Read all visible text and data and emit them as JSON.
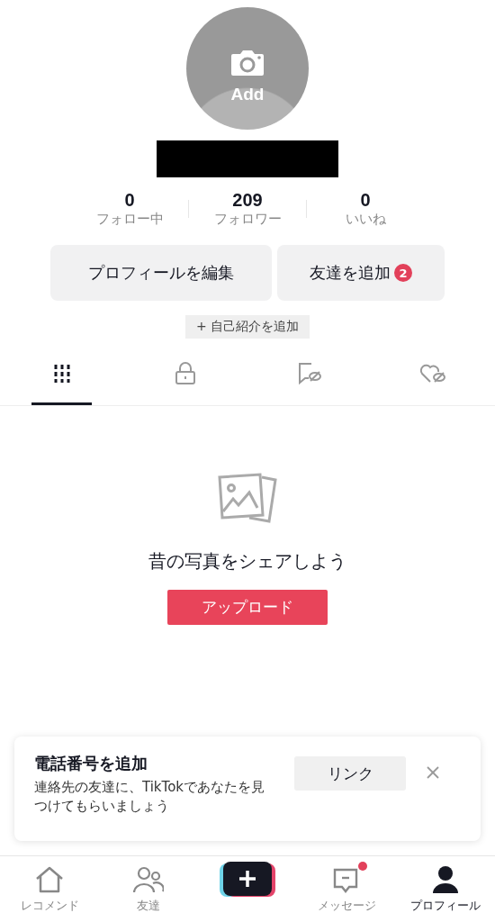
{
  "avatar": {
    "label": "Add"
  },
  "stats": [
    {
      "value": "0",
      "label": "フォロー中"
    },
    {
      "value": "209",
      "label": "フォロワー"
    },
    {
      "value": "0",
      "label": "いいね"
    }
  ],
  "buttons": [
    {
      "label": "プロフィールを編集"
    },
    {
      "label": "友達を追加",
      "badge": "2"
    }
  ],
  "bio_button": "+ 自己紹介を追加",
  "tabs": [
    {
      "kind": "videos",
      "selected": true
    },
    {
      "kind": "private",
      "selected": false
    },
    {
      "kind": "favorites",
      "selected": false
    },
    {
      "kind": "liked",
      "selected": false
    }
  ],
  "empty": {
    "message": "昔の写真をシェアしよう",
    "button": "アップロード"
  },
  "banner": {
    "title": "電話番号を追加",
    "text": "連絡先の友達に、TikTokであなたを見つけてもらいましょう",
    "button": "リンク"
  },
  "nav": [
    {
      "kind": "home",
      "label": "レコメンド",
      "selected": false,
      "unread": false
    },
    {
      "kind": "friends",
      "label": "友達",
      "selected": false,
      "unread": false
    },
    {
      "kind": "create"
    },
    {
      "kind": "inbox",
      "label": "メッセージ",
      "selected": false,
      "unread": true
    },
    {
      "kind": "profile",
      "label": "プロフィール",
      "selected": true,
      "unread": false
    }
  ]
}
